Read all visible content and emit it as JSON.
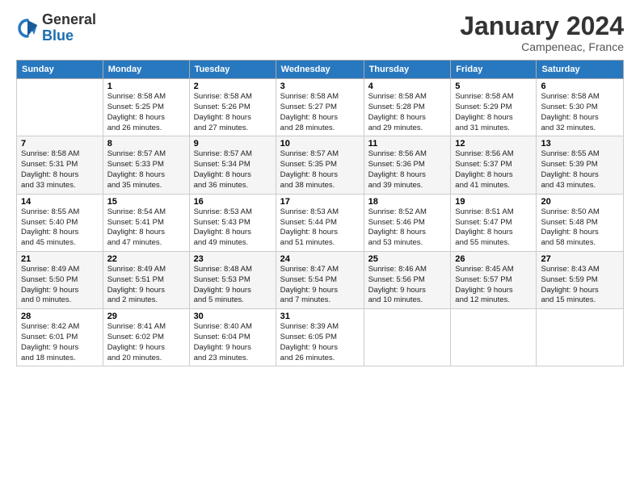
{
  "logo": {
    "general": "General",
    "blue": "Blue"
  },
  "header": {
    "title": "January 2024",
    "location": "Campeneac, France"
  },
  "weekdays": [
    "Sunday",
    "Monday",
    "Tuesday",
    "Wednesday",
    "Thursday",
    "Friday",
    "Saturday"
  ],
  "weeks": [
    [
      {
        "day": null,
        "info": null
      },
      {
        "day": "1",
        "info": "Sunrise: 8:58 AM\nSunset: 5:25 PM\nDaylight: 8 hours\nand 26 minutes."
      },
      {
        "day": "2",
        "info": "Sunrise: 8:58 AM\nSunset: 5:26 PM\nDaylight: 8 hours\nand 27 minutes."
      },
      {
        "day": "3",
        "info": "Sunrise: 8:58 AM\nSunset: 5:27 PM\nDaylight: 8 hours\nand 28 minutes."
      },
      {
        "day": "4",
        "info": "Sunrise: 8:58 AM\nSunset: 5:28 PM\nDaylight: 8 hours\nand 29 minutes."
      },
      {
        "day": "5",
        "info": "Sunrise: 8:58 AM\nSunset: 5:29 PM\nDaylight: 8 hours\nand 31 minutes."
      },
      {
        "day": "6",
        "info": "Sunrise: 8:58 AM\nSunset: 5:30 PM\nDaylight: 8 hours\nand 32 minutes."
      }
    ],
    [
      {
        "day": "7",
        "info": "Sunrise: 8:58 AM\nSunset: 5:31 PM\nDaylight: 8 hours\nand 33 minutes."
      },
      {
        "day": "8",
        "info": "Sunrise: 8:57 AM\nSunset: 5:33 PM\nDaylight: 8 hours\nand 35 minutes."
      },
      {
        "day": "9",
        "info": "Sunrise: 8:57 AM\nSunset: 5:34 PM\nDaylight: 8 hours\nand 36 minutes."
      },
      {
        "day": "10",
        "info": "Sunrise: 8:57 AM\nSunset: 5:35 PM\nDaylight: 8 hours\nand 38 minutes."
      },
      {
        "day": "11",
        "info": "Sunrise: 8:56 AM\nSunset: 5:36 PM\nDaylight: 8 hours\nand 39 minutes."
      },
      {
        "day": "12",
        "info": "Sunrise: 8:56 AM\nSunset: 5:37 PM\nDaylight: 8 hours\nand 41 minutes."
      },
      {
        "day": "13",
        "info": "Sunrise: 8:55 AM\nSunset: 5:39 PM\nDaylight: 8 hours\nand 43 minutes."
      }
    ],
    [
      {
        "day": "14",
        "info": "Sunrise: 8:55 AM\nSunset: 5:40 PM\nDaylight: 8 hours\nand 45 minutes."
      },
      {
        "day": "15",
        "info": "Sunrise: 8:54 AM\nSunset: 5:41 PM\nDaylight: 8 hours\nand 47 minutes."
      },
      {
        "day": "16",
        "info": "Sunrise: 8:53 AM\nSunset: 5:43 PM\nDaylight: 8 hours\nand 49 minutes."
      },
      {
        "day": "17",
        "info": "Sunrise: 8:53 AM\nSunset: 5:44 PM\nDaylight: 8 hours\nand 51 minutes."
      },
      {
        "day": "18",
        "info": "Sunrise: 8:52 AM\nSunset: 5:46 PM\nDaylight: 8 hours\nand 53 minutes."
      },
      {
        "day": "19",
        "info": "Sunrise: 8:51 AM\nSunset: 5:47 PM\nDaylight: 8 hours\nand 55 minutes."
      },
      {
        "day": "20",
        "info": "Sunrise: 8:50 AM\nSunset: 5:48 PM\nDaylight: 8 hours\nand 58 minutes."
      }
    ],
    [
      {
        "day": "21",
        "info": "Sunrise: 8:49 AM\nSunset: 5:50 PM\nDaylight: 9 hours\nand 0 minutes."
      },
      {
        "day": "22",
        "info": "Sunrise: 8:49 AM\nSunset: 5:51 PM\nDaylight: 9 hours\nand 2 minutes."
      },
      {
        "day": "23",
        "info": "Sunrise: 8:48 AM\nSunset: 5:53 PM\nDaylight: 9 hours\nand 5 minutes."
      },
      {
        "day": "24",
        "info": "Sunrise: 8:47 AM\nSunset: 5:54 PM\nDaylight: 9 hours\nand 7 minutes."
      },
      {
        "day": "25",
        "info": "Sunrise: 8:46 AM\nSunset: 5:56 PM\nDaylight: 9 hours\nand 10 minutes."
      },
      {
        "day": "26",
        "info": "Sunrise: 8:45 AM\nSunset: 5:57 PM\nDaylight: 9 hours\nand 12 minutes."
      },
      {
        "day": "27",
        "info": "Sunrise: 8:43 AM\nSunset: 5:59 PM\nDaylight: 9 hours\nand 15 minutes."
      }
    ],
    [
      {
        "day": "28",
        "info": "Sunrise: 8:42 AM\nSunset: 6:01 PM\nDaylight: 9 hours\nand 18 minutes."
      },
      {
        "day": "29",
        "info": "Sunrise: 8:41 AM\nSunset: 6:02 PM\nDaylight: 9 hours\nand 20 minutes."
      },
      {
        "day": "30",
        "info": "Sunrise: 8:40 AM\nSunset: 6:04 PM\nDaylight: 9 hours\nand 23 minutes."
      },
      {
        "day": "31",
        "info": "Sunrise: 8:39 AM\nSunset: 6:05 PM\nDaylight: 9 hours\nand 26 minutes."
      },
      {
        "day": null,
        "info": null
      },
      {
        "day": null,
        "info": null
      },
      {
        "day": null,
        "info": null
      }
    ]
  ]
}
